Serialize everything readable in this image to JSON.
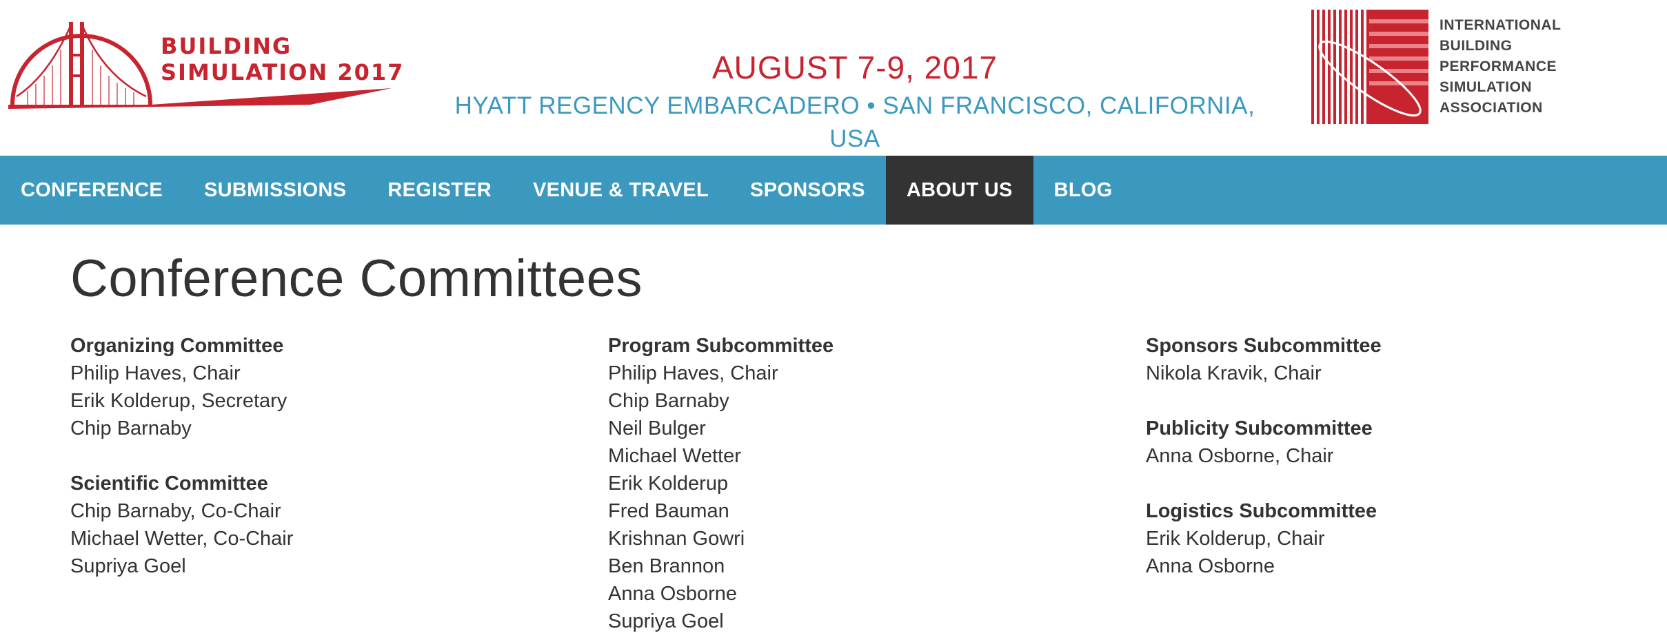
{
  "header": {
    "logo_line1": "BUILDING",
    "logo_line2": "SIMULATION 2017",
    "date": "AUGUST 7-9, 2017",
    "venue": "HYATT REGENCY EMBARCADERO • SAN FRANCISCO, CALIFORNIA, USA",
    "association_lines": [
      "INTERNATIONAL",
      "BUILDING",
      "PERFORMANCE",
      "SIMULATION",
      "ASSOCIATION"
    ]
  },
  "nav": {
    "items": [
      {
        "label": "CONFERENCE"
      },
      {
        "label": "SUBMISSIONS"
      },
      {
        "label": "REGISTER"
      },
      {
        "label": "VENUE & TRAVEL"
      },
      {
        "label": "SPONSORS"
      },
      {
        "label": "ABOUT US",
        "active": true
      },
      {
        "label": "BLOG"
      }
    ]
  },
  "page": {
    "title": "Conference Committees"
  },
  "columns": [
    {
      "groups": [
        {
          "title": "Organizing Committee",
          "members": [
            "Philip Haves, Chair",
            "Erik Kolderup, Secretary",
            "Chip Barnaby"
          ]
        },
        {
          "title": "Scientific Committee",
          "members": [
            "Chip Barnaby, Co-Chair",
            "Michael Wetter, Co-Chair",
            "Supriya Goel"
          ]
        }
      ]
    },
    {
      "groups": [
        {
          "title": "Program Subcommittee",
          "members": [
            "Philip Haves, Chair",
            "Chip Barnaby",
            "Neil Bulger",
            "Michael Wetter",
            "Erik Kolderup",
            "Fred Bauman",
            "Krishnan Gowri",
            "Ben Brannon",
            "Anna Osborne",
            "Supriya Goel"
          ]
        }
      ]
    },
    {
      "groups": [
        {
          "title": "Sponsors Subcommittee",
          "members": [
            "Nikola Kravik, Chair"
          ]
        },
        {
          "title": "Publicity Subcommittee",
          "members": [
            "Anna Osborne, Chair"
          ]
        },
        {
          "title": "Logistics Subcommittee",
          "members": [
            "Erik Kolderup, Chair",
            "Anna Osborne"
          ]
        }
      ]
    }
  ],
  "colors": {
    "brand_red": "#c8242f",
    "brand_blue": "#3b99bf",
    "nav_active": "#333333",
    "text": "#333333"
  },
  "icons": [
    "golden-gate-bridge-logo",
    "ibpsa-logo"
  ]
}
